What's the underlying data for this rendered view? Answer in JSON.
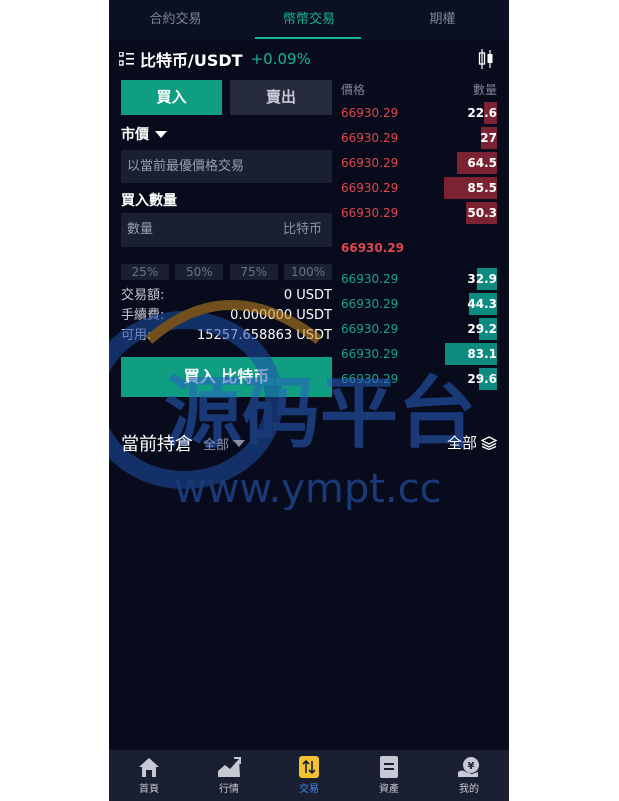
{
  "top_tabs": [
    "合約交易",
    "幣幣交易",
    "期權"
  ],
  "pair": {
    "name": "比特币/USDT",
    "change": "+0.09%"
  },
  "trade_buttons": {
    "buy": "買入",
    "sell": "賣出"
  },
  "order_type": "市價",
  "market_price_hint": "以當前最優價格交易",
  "qty_label": "買入數量",
  "qty_field": {
    "placeholder": "數量",
    "unit": "比特币"
  },
  "percent_buttons": [
    "25%",
    "50%",
    "75%",
    "100%"
  ],
  "info": [
    {
      "label": "交易額:",
      "value": "0 USDT"
    },
    {
      "label": "手續費:",
      "value": "0.000000 USDT"
    },
    {
      "label": "可用:",
      "value": "15257.658863 USDT"
    }
  ],
  "submit_label": "買入 比特币",
  "orderbook": {
    "headers": {
      "price": "價格",
      "amount": "數量"
    },
    "asks": [
      {
        "price": "66930.29",
        "amount": "22.6"
      },
      {
        "price": "66930.29",
        "amount": "27"
      },
      {
        "price": "66930.29",
        "amount": "64.5"
      },
      {
        "price": "66930.29",
        "amount": "85.5"
      },
      {
        "price": "66930.29",
        "amount": "50.3"
      }
    ],
    "last_price": "66930.29",
    "bids": [
      {
        "price": "66930.29",
        "amount": "32.9"
      },
      {
        "price": "66930.29",
        "amount": "44.3"
      },
      {
        "price": "66930.29",
        "amount": "29.2"
      },
      {
        "price": "66930.29",
        "amount": "83.1"
      },
      {
        "price": "66930.29",
        "amount": "29.6"
      }
    ]
  },
  "holdings": {
    "title": "當前持倉",
    "filter": "全部",
    "all_button": "全部"
  },
  "watermark": {
    "text": "源码平台",
    "url": "www.ympt.cc"
  },
  "bottom_nav": [
    "首頁",
    "行情",
    "交易",
    "資產",
    "我的"
  ],
  "colors": {
    "accent": "#19b394",
    "buy_green": "#109e83",
    "ask_red": "#e0474e",
    "nav_active": "#3f8cf0"
  }
}
